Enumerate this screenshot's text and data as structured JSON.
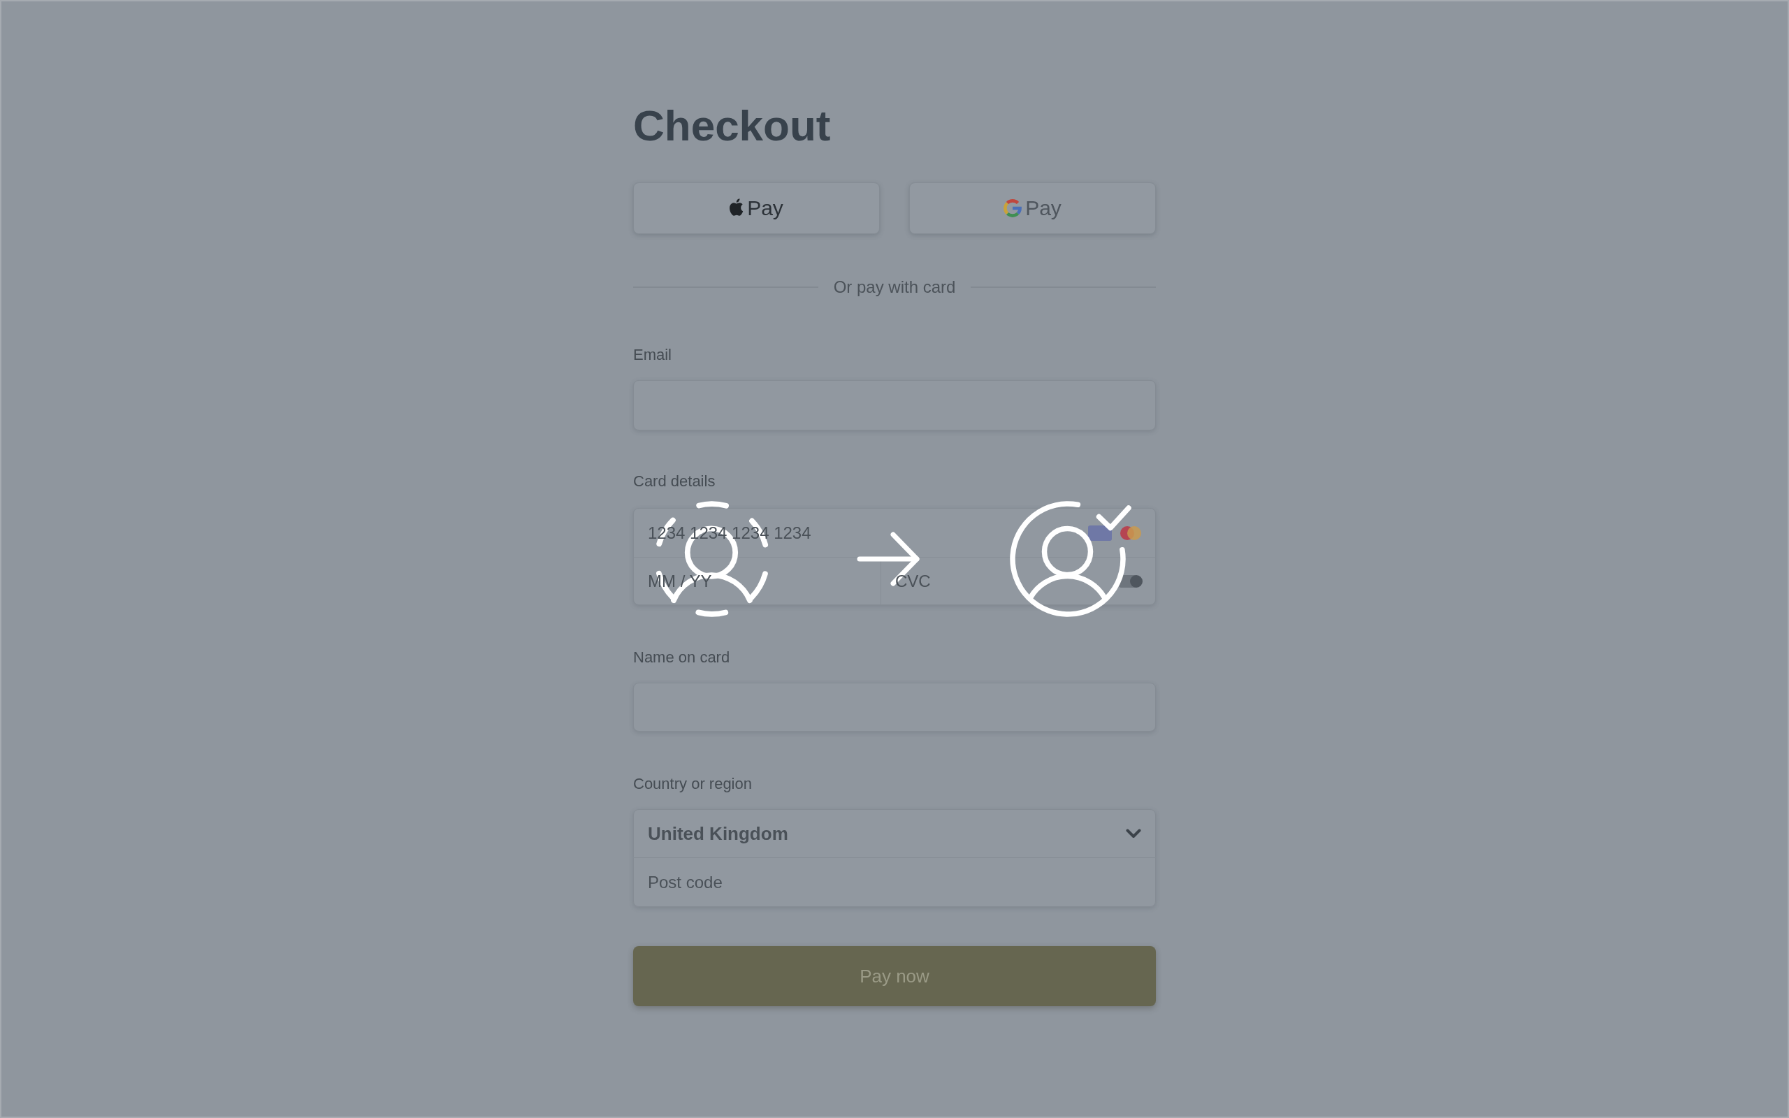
{
  "page": {
    "title": "Checkout"
  },
  "wallet_buttons": [
    {
      "kind": "apple",
      "label": "Pay"
    },
    {
      "kind": "google",
      "label": "Pay"
    }
  ],
  "divider": {
    "text": "Or pay with card"
  },
  "email": {
    "label": "Email"
  },
  "card_details": {
    "label": "Card details",
    "number": {
      "placeholder": "1234 1234 1234 1234"
    },
    "expiry": {
      "placeholder": "MM / YY"
    },
    "cvc": {
      "placeholder": "CVC"
    }
  },
  "name_on_card": {
    "label": "Name on card"
  },
  "country": {
    "label": "Country or region",
    "select": {
      "value": "United Kingdom"
    },
    "postcode": {
      "placeholder": "Post code"
    }
  },
  "pay_button": {
    "label": "Pay now"
  }
}
